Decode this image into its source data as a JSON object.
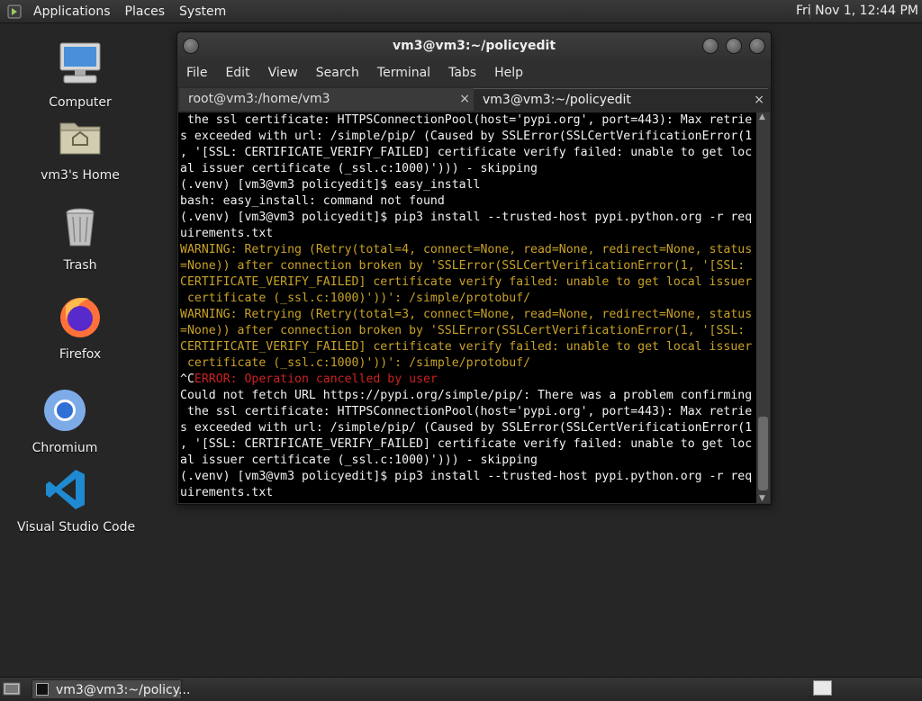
{
  "top_panel": {
    "menus": [
      "Applications",
      "Places",
      "System"
    ],
    "clock": "Fri Nov 1, 12:44 PM"
  },
  "desktop_icons": [
    {
      "label": "Computer",
      "icon": "computer-icon"
    },
    {
      "label": "vm3's Home",
      "icon": "home-folder-icon"
    },
    {
      "label": "Trash",
      "icon": "trash-icon"
    },
    {
      "label": "Firefox",
      "icon": "firefox-icon"
    },
    {
      "label": "Chromium",
      "icon": "chromium-icon"
    },
    {
      "label": "Visual Studio Code",
      "icon": "vscode-icon"
    }
  ],
  "window": {
    "title": "vm3@vm3:~/policyedit",
    "menu": [
      "File",
      "Edit",
      "View",
      "Search",
      "Terminal",
      "Tabs",
      "Help"
    ],
    "tabs": [
      {
        "label": "root@vm3:/home/vm3",
        "active": false
      },
      {
        "label": "vm3@vm3:~/policyedit",
        "active": true
      }
    ],
    "close_glyph": "×"
  },
  "terminal": {
    "lines": [
      {
        "text": " the ssl certificate: HTTPSConnectionPool(host='pypi.org', port=443): Max retrie",
        "kind": "normal"
      },
      {
        "text": "s exceeded with url: /simple/pip/ (Caused by SSLError(SSLCertVerificationError(1",
        "kind": "normal"
      },
      {
        "text": ", '[SSL: CERTIFICATE_VERIFY_FAILED] certificate verify failed: unable to get loc",
        "kind": "normal"
      },
      {
        "text": "al issuer certificate (_ssl.c:1000)'))) - skipping",
        "kind": "normal"
      },
      {
        "text": "(.venv) [vm3@vm3 policyedit]$ easy_install",
        "kind": "normal"
      },
      {
        "text": "bash: easy_install: command not found",
        "kind": "normal"
      },
      {
        "text": "(.venv) [vm3@vm3 policyedit]$ pip3 install --trusted-host pypi.python.org -r req",
        "kind": "normal"
      },
      {
        "text": "uirements.txt",
        "kind": "normal"
      },
      {
        "text": "WARNING: Retrying (Retry(total=4, connect=None, read=None, redirect=None, status",
        "kind": "warn"
      },
      {
        "text": "=None)) after connection broken by 'SSLError(SSLCertVerificationError(1, '[SSL:",
        "kind": "warn"
      },
      {
        "text": "CERTIFICATE_VERIFY_FAILED] certificate verify failed: unable to get local issuer",
        "kind": "warn"
      },
      {
        "text": " certificate (_ssl.c:1000)'))': /simple/protobuf/",
        "kind": "warn"
      },
      {
        "text": "WARNING: Retrying (Retry(total=3, connect=None, read=None, redirect=None, status",
        "kind": "warn"
      },
      {
        "text": "=None)) after connection broken by 'SSLError(SSLCertVerificationError(1, '[SSL:",
        "kind": "warn"
      },
      {
        "text": "CERTIFICATE_VERIFY_FAILED] certificate verify failed: unable to get local issuer",
        "kind": "warn"
      },
      {
        "text": " certificate (_ssl.c:1000)'))': /simple/protobuf/",
        "kind": "warn"
      },
      {
        "prefix": "^C",
        "text": "ERROR: Operation cancelled by user",
        "kind": "err"
      },
      {
        "text": "Could not fetch URL https://pypi.org/simple/pip/: There was a problem confirming",
        "kind": "normal"
      },
      {
        "text": " the ssl certificate: HTTPSConnectionPool(host='pypi.org', port=443): Max retrie",
        "kind": "normal"
      },
      {
        "text": "s exceeded with url: /simple/pip/ (Caused by SSLError(SSLCertVerificationError(1",
        "kind": "normal"
      },
      {
        "text": ", '[SSL: CERTIFICATE_VERIFY_FAILED] certificate verify failed: unable to get loc",
        "kind": "normal"
      },
      {
        "text": "al issuer certificate (_ssl.c:1000)'))) - skipping",
        "kind": "normal"
      },
      {
        "text": "(.venv) [vm3@vm3 policyedit]$ pip3 install --trusted-host pypi.python.org -r req",
        "kind": "normal"
      },
      {
        "text": "uirements.txt",
        "kind": "normal"
      }
    ]
  },
  "taskbar": {
    "task_label": "vm3@vm3:~/policy..."
  },
  "colors": {
    "warning": "#c9a227",
    "error": "#cc2222",
    "terminal_bg": "#000000",
    "desktop_bg": "#262626"
  }
}
